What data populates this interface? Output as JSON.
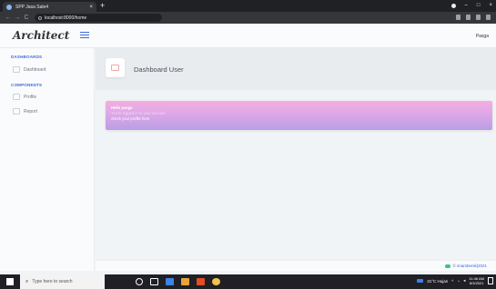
{
  "browser": {
    "tab_title": "SPP Jasa Sale4",
    "tab_close": "×",
    "new_tab": "+",
    "url": "localhost:8000/home",
    "nav_back": "←",
    "nav_forward": "→",
    "nav_reload": "C"
  },
  "header": {
    "logo": "Architect",
    "user_name": "Pasga"
  },
  "sidebar": {
    "sections": [
      {
        "title": "DASHBOARDS",
        "items": [
          {
            "label": "Dashboard",
            "icon": "dashboard-icon"
          }
        ]
      },
      {
        "title": "COMPONENTS",
        "items": [
          {
            "label": "Profile",
            "icon": "profile-icon"
          },
          {
            "label": "Report",
            "icon": "report-icon"
          }
        ]
      }
    ]
  },
  "page_title": {
    "heading": "Dashboard User",
    "icon": "dashboard-icon"
  },
  "welcome_card": {
    "line1": "Hello pasga",
    "line2": "You're logged in to your account",
    "line3": "check your profile here"
  },
  "footer": {
    "credit": "© imambenik|2021"
  },
  "taskbar": {
    "search_placeholder": "Type here to search",
    "weather": "31°C Hujan",
    "time": "11:46 AM",
    "date": "8/3/2021"
  },
  "colors": {
    "accent": "#3f6ad8",
    "card_gradient_top": "#f4aee0",
    "card_gradient_bottom": "#b89ee2",
    "success": "#3ac47d"
  }
}
